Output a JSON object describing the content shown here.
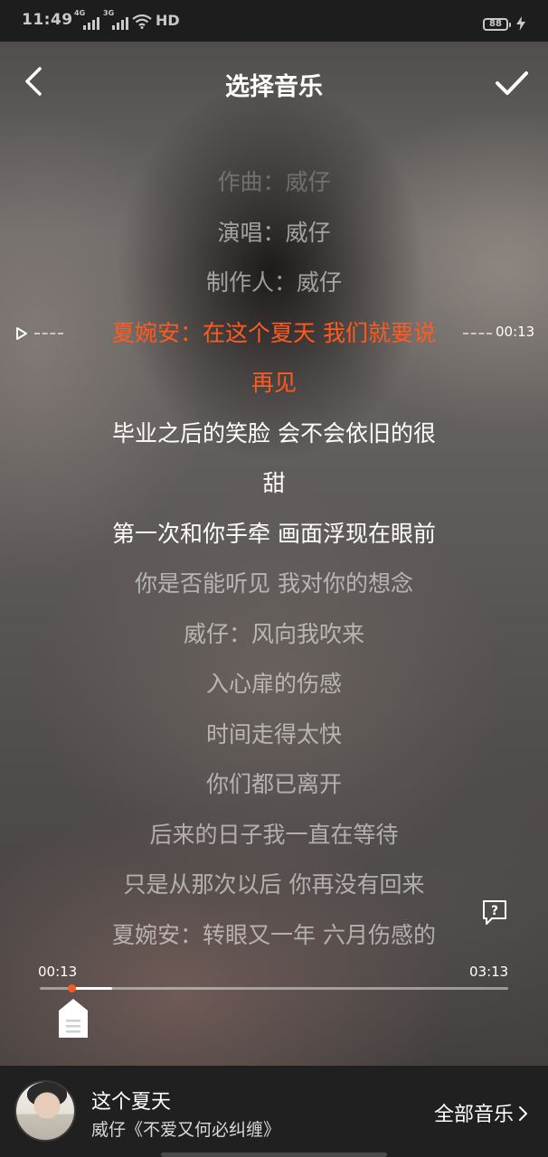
{
  "status_bar": {
    "time": "11:49",
    "signal1_tag": "4G",
    "signal2_tag": "3G",
    "network": "HD",
    "battery": "88"
  },
  "header": {
    "title": "选择音乐"
  },
  "lyrics": [
    "作曲：威仔",
    "演唱：威仔",
    "制作人：威仔",
    "夏婉安：在这个夏天 我们就要说",
    "再见",
    "毕业之后的笑脸 会不会依旧的很",
    "甜",
    "第一次和你手牵 画面浮现在眼前",
    "你是否能听见 我对你的想念",
    "威仔：风向我吹来",
    "入心扉的伤感",
    "时间走得太快",
    "你们都已离开",
    "后来的日子我一直在等待",
    "只是从那次以后 你再没有回来",
    "夏婉安：转眼又一年 六月伤感的"
  ],
  "marker": {
    "time": "00:13"
  },
  "progress": {
    "current": "00:13",
    "total": "03:13",
    "position_fraction": 0.068,
    "selection_end_fraction": 0.154
  },
  "now_playing": {
    "song": "这个夏天",
    "artist": "威仔《不爱又何必纠缠》"
  },
  "footer": {
    "all_music_label": "全部音乐"
  },
  "colors": {
    "accent": "#ff5a1f",
    "bottom_bar": "#202020",
    "status_bar": "#1d1d1d"
  }
}
